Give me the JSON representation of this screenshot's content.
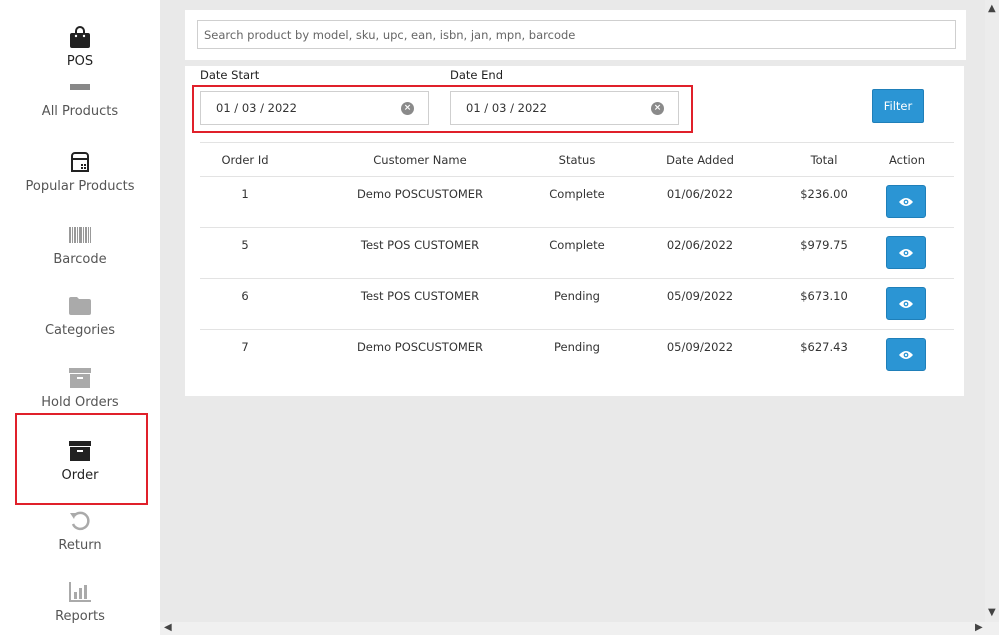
{
  "sidebar": {
    "items": [
      {
        "label": "POS",
        "icon": "shopping-bag-icon"
      },
      {
        "label": "All Products",
        "icon": "folder-icon"
      },
      {
        "label": "Popular Products",
        "icon": "cash-register-icon"
      },
      {
        "label": "Barcode",
        "icon": "barcode-icon"
      },
      {
        "label": "Categories",
        "icon": "folder-icon"
      },
      {
        "label": "Hold Orders",
        "icon": "archive-box-icon"
      },
      {
        "label": "Order",
        "icon": "archive-box-icon"
      },
      {
        "label": "Return",
        "icon": "undo-icon"
      },
      {
        "label": "Reports",
        "icon": "bar-chart-icon"
      }
    ],
    "active": "Order"
  },
  "search": {
    "placeholder": "Search product by model, sku, upc, ean, isbn, jan, mpn, barcode"
  },
  "filters": {
    "date_start_label": "Date Start",
    "date_start_value": "01 / 03 / 2022",
    "date_end_label": "Date End",
    "date_end_value": "01 / 03 / 2022",
    "filter_button": "Filter"
  },
  "table": {
    "headers": [
      "Order Id",
      "Customer Name",
      "Status",
      "Date Added",
      "Total",
      "Action"
    ],
    "rows": [
      {
        "id": "1",
        "customer": "Demo POSCUSTOMER",
        "status": "Complete",
        "date": "01/06/2022",
        "total": "$236.00"
      },
      {
        "id": "5",
        "customer": "Test POS CUSTOMER",
        "status": "Complete",
        "date": "02/06/2022",
        "total": "$979.75"
      },
      {
        "id": "6",
        "customer": "Test POS CUSTOMER",
        "status": "Pending",
        "date": "05/09/2022",
        "total": "$673.10"
      },
      {
        "id": "7",
        "customer": "Demo POSCUSTOMER",
        "status": "Pending",
        "date": "05/09/2022",
        "total": "$627.43"
      }
    ]
  },
  "colors": {
    "accent": "#2b95d4",
    "highlight": "#e0202a"
  }
}
